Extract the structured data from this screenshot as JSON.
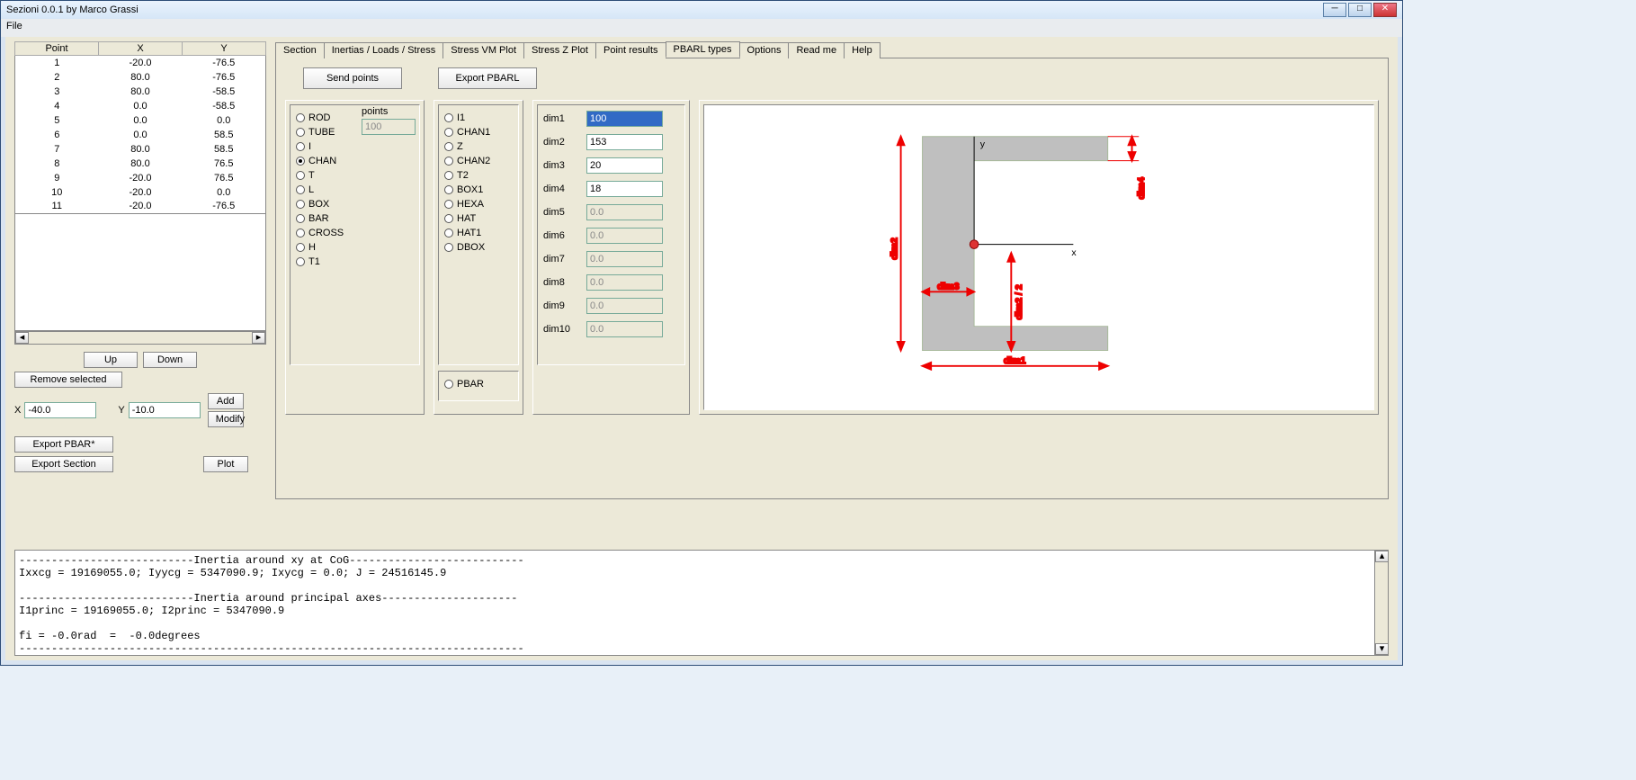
{
  "window_title": "Sezioni 0.0.1 by Marco Grassi",
  "menu": {
    "file": "File"
  },
  "table": {
    "headers": [
      "Point",
      "X",
      "Y"
    ],
    "rows": [
      {
        "p": "1",
        "x": "-20.0",
        "y": "-76.5"
      },
      {
        "p": "2",
        "x": "80.0",
        "y": "-76.5"
      },
      {
        "p": "3",
        "x": "80.0",
        "y": "-58.5"
      },
      {
        "p": "4",
        "x": "0.0",
        "y": "-58.5"
      },
      {
        "p": "5",
        "x": "0.0",
        "y": "0.0"
      },
      {
        "p": "6",
        "x": "0.0",
        "y": "58.5"
      },
      {
        "p": "7",
        "x": "80.0",
        "y": "58.5"
      },
      {
        "p": "8",
        "x": "80.0",
        "y": "76.5"
      },
      {
        "p": "9",
        "x": "-20.0",
        "y": "76.5"
      },
      {
        "p": "10",
        "x": "-20.0",
        "y": "0.0"
      },
      {
        "p": "11",
        "x": "-20.0",
        "y": "-76.5"
      }
    ]
  },
  "left_buttons": {
    "up": "Up",
    "down": "Down",
    "remove": "Remove selected",
    "x_label": "X",
    "y_label": "Y",
    "x_val": "-40.0",
    "y_val": "-10.0",
    "add": "Add",
    "modify": "Modify",
    "export_pbar": "Export PBAR*",
    "export_section": "Export Section",
    "plot": "Plot"
  },
  "tabs": [
    "Section",
    "Inertias / Loads / Stress",
    "Stress VM Plot",
    "Stress Z Plot",
    "Point results",
    "PBARL types",
    "Options",
    "Read me",
    "Help"
  ],
  "active_tab": 5,
  "pbarl": {
    "send": "Send points",
    "export": "Export PBARL",
    "col1": [
      "ROD",
      "TUBE",
      "I",
      "CHAN",
      "T",
      "L",
      "BOX",
      "BAR",
      "CROSS",
      "H",
      "T1"
    ],
    "col1_selected": 3,
    "points_label": "points",
    "points_val": "100",
    "col2": [
      "I1",
      "CHAN1",
      "Z",
      "CHAN2",
      "T2",
      "BOX1",
      "HEXA",
      "HAT",
      "HAT1",
      "DBOX"
    ],
    "col2_selected": -1,
    "pbar": "PBAR",
    "dims": [
      {
        "label": "dim1",
        "val": "100",
        "enabled": true,
        "sel": true
      },
      {
        "label": "dim2",
        "val": "153",
        "enabled": true
      },
      {
        "label": "dim3",
        "val": "20",
        "enabled": true
      },
      {
        "label": "dim4",
        "val": "18",
        "enabled": true
      },
      {
        "label": "dim5",
        "val": "0.0",
        "enabled": false
      },
      {
        "label": "dim6",
        "val": "0.0",
        "enabled": false
      },
      {
        "label": "dim7",
        "val": "0.0",
        "enabled": false
      },
      {
        "label": "dim8",
        "val": "0.0",
        "enabled": false
      },
      {
        "label": "dim9",
        "val": "0.0",
        "enabled": false
      },
      {
        "label": "dim10",
        "val": "0.0",
        "enabled": false
      }
    ]
  },
  "diagram": {
    "y": "y",
    "x": "x",
    "dim1": "dim1",
    "dim2": "dim2",
    "dim3": "dim3",
    "dim4": "dim4",
    "dim22": "dim2 / 2"
  },
  "output": "---------------------------Inertia around xy at CoG---------------------------\nIxxcg = 19169055.0; Iyycg = 5347090.9; Ixycg = 0.0; J = 24516145.9\n\n---------------------------Inertia around principal axes---------------------\nI1princ = 19169055.0; I2princ = 5347090.9\n\nfi = -0.0rad  =  -0.0degrees\n------------------------------------------------------------------------------"
}
